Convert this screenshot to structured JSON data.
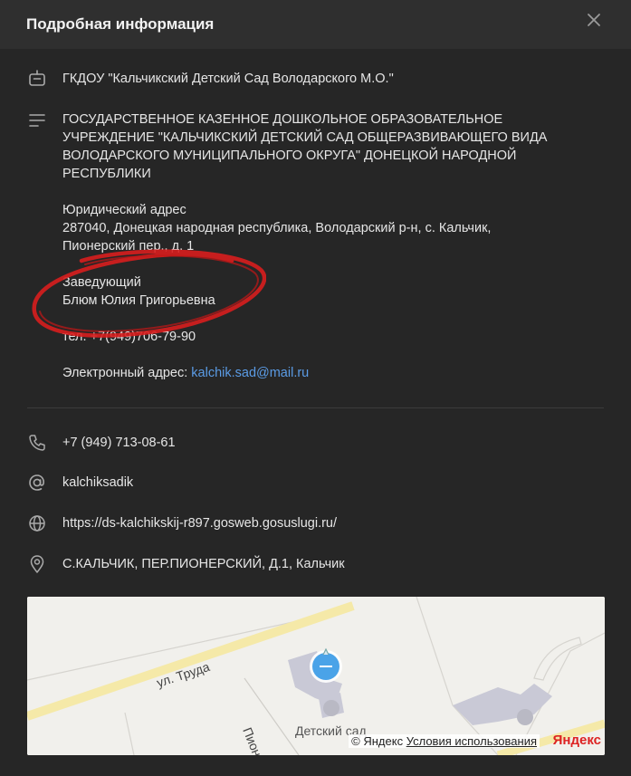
{
  "header": {
    "title": "Подробная информация"
  },
  "org": {
    "short_name": "ГКДОУ \"Кальчикский Детский Сад Володарского М.О.\"",
    "full_name_lines": [
      "ГОСУДАРСТВЕННОЕ КАЗЕННОЕ ДОШКОЛЬНОЕ ОБРАЗОВАТЕЛЬНОЕ",
      "УЧРЕЖДЕНИЕ \"КАЛЬЧИКСКИЙ ДЕТСКИЙ САД ОБЩЕРАЗВИВАЮЩЕГО ВИДА",
      "ВОЛОДАРСКОГО МУНИЦИПАЛЬНОГО ОКРУГА\" ДОНЕЦКОЙ НАРОДНОЙ",
      "РЕСПУБЛИКИ"
    ],
    "legal_address_label": "Юридический адрес",
    "legal_address_line1": "287040, Донецкая народная республика, Володарский р-н, с. Кальчик,",
    "legal_address_line2": "Пионерский пер., д. 1",
    "head_label": "Заведующий",
    "head_name": "Блюм Юлия Григорьевна",
    "phone_text": "тел. +7(949)706-79-90",
    "email_label": "Электронный адрес: ",
    "email": "kalchik.sad@mail.ru"
  },
  "contacts": {
    "phone": "+7 (949) 713-08-61",
    "username": "kalchiksadik",
    "website": "https://ds-kalchikskij-r897.gosweb.gosuslugi.ru/",
    "address": "С.КАЛЬЧИК, ПЕР.ПИОНЕРСКИЙ, Д.1, Кальчик"
  },
  "map": {
    "street_main": "ул. Труда",
    "street_side": "Пионерс",
    "poi_label": "Детский сад",
    "credit": "© Яндекс ",
    "terms": "Условия использования",
    "logo": "Яндекс"
  },
  "colors": {
    "background": "#262626",
    "header": "#2f2f2f",
    "link": "#5b9ce6",
    "annotation": "#d81e1e"
  }
}
